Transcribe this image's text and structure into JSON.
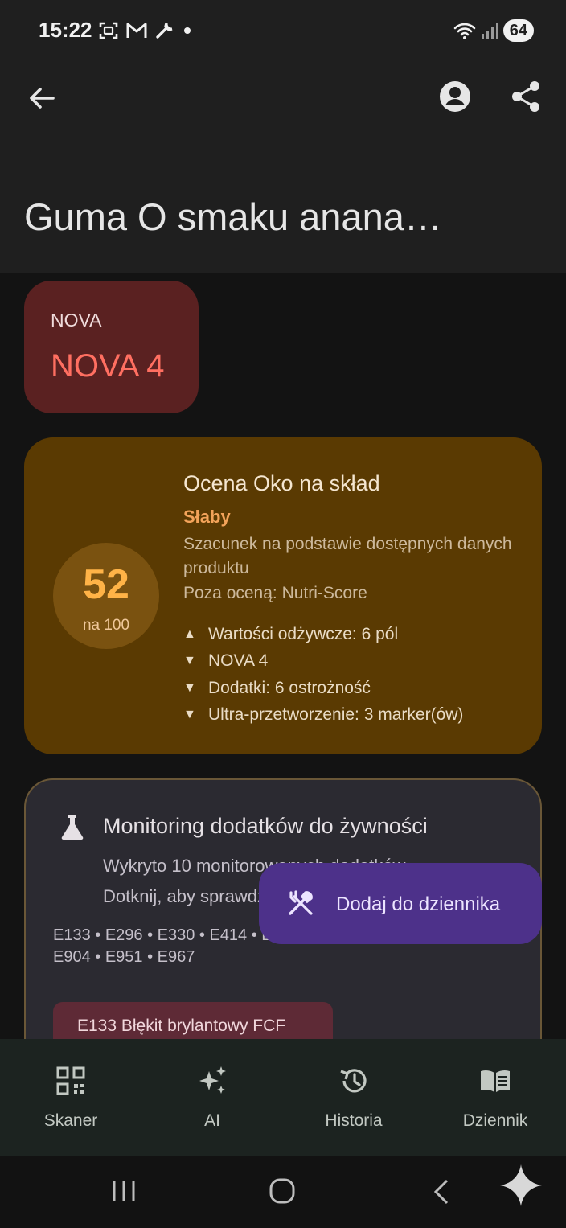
{
  "status_bar": {
    "time": "15:22",
    "battery": "64",
    "icons": [
      "screenshot-icon",
      "gmail-icon",
      "wrench-icon",
      "dot-icon",
      "wifi-icon",
      "signal-icon",
      "battery-icon"
    ]
  },
  "app_bar": {
    "title": "Guma O smaku anana…",
    "icons": [
      "back-arrow-icon",
      "account-circle-icon",
      "share-icon"
    ]
  },
  "nova": {
    "label": "NOVA",
    "value": "NOVA 4",
    "color": "#ff6f61"
  },
  "score": {
    "number": "52",
    "out_of": "na 100",
    "title": "Ocena Oko na skład",
    "rating": "Słaby",
    "description": "Szacunek na podstawie dostępnych danych produktu",
    "excluded": "Poza oceną: Nutri-Score",
    "factors": [
      {
        "arrow": "▲",
        "text": "Wartości odżywcze: 6 pól"
      },
      {
        "arrow": "▼",
        "text": "NOVA 4"
      },
      {
        "arrow": "▼",
        "text": "Dodatki: 6 ostrożność"
      },
      {
        "arrow": "▼",
        "text": "Ultra-przetworzenie: 3 marker(ów)"
      }
    ],
    "accent_color": "#ffb347"
  },
  "additives": {
    "icon": "flask-icon",
    "title": "Monitoring dodatków do żywności",
    "subtitle_line1": "Wykryto 10 monitorowanych dodatków.",
    "subtitle_line2": "Dotknij, aby sprawdzić szczegóły.",
    "codes": "E133 • E296 • E330 • E414 • E422 • E471 • E903 • E904 • E951 • E967",
    "chip": "E133 Błękit brylantowy FCF"
  },
  "fab": {
    "icon": "utensils-icon",
    "label": "Dodaj do dziennika"
  },
  "bottom_nav": {
    "items": [
      {
        "label": "Skaner",
        "icon": "qr-scanner-icon"
      },
      {
        "label": "AI",
        "icon": "sparkles-icon"
      },
      {
        "label": "Historia",
        "icon": "history-icon"
      },
      {
        "label": "Dziennik",
        "icon": "book-icon"
      }
    ]
  },
  "system_nav": {
    "icons": [
      "recents-icon",
      "home-icon",
      "back-icon",
      "assistant-star-icon"
    ]
  }
}
